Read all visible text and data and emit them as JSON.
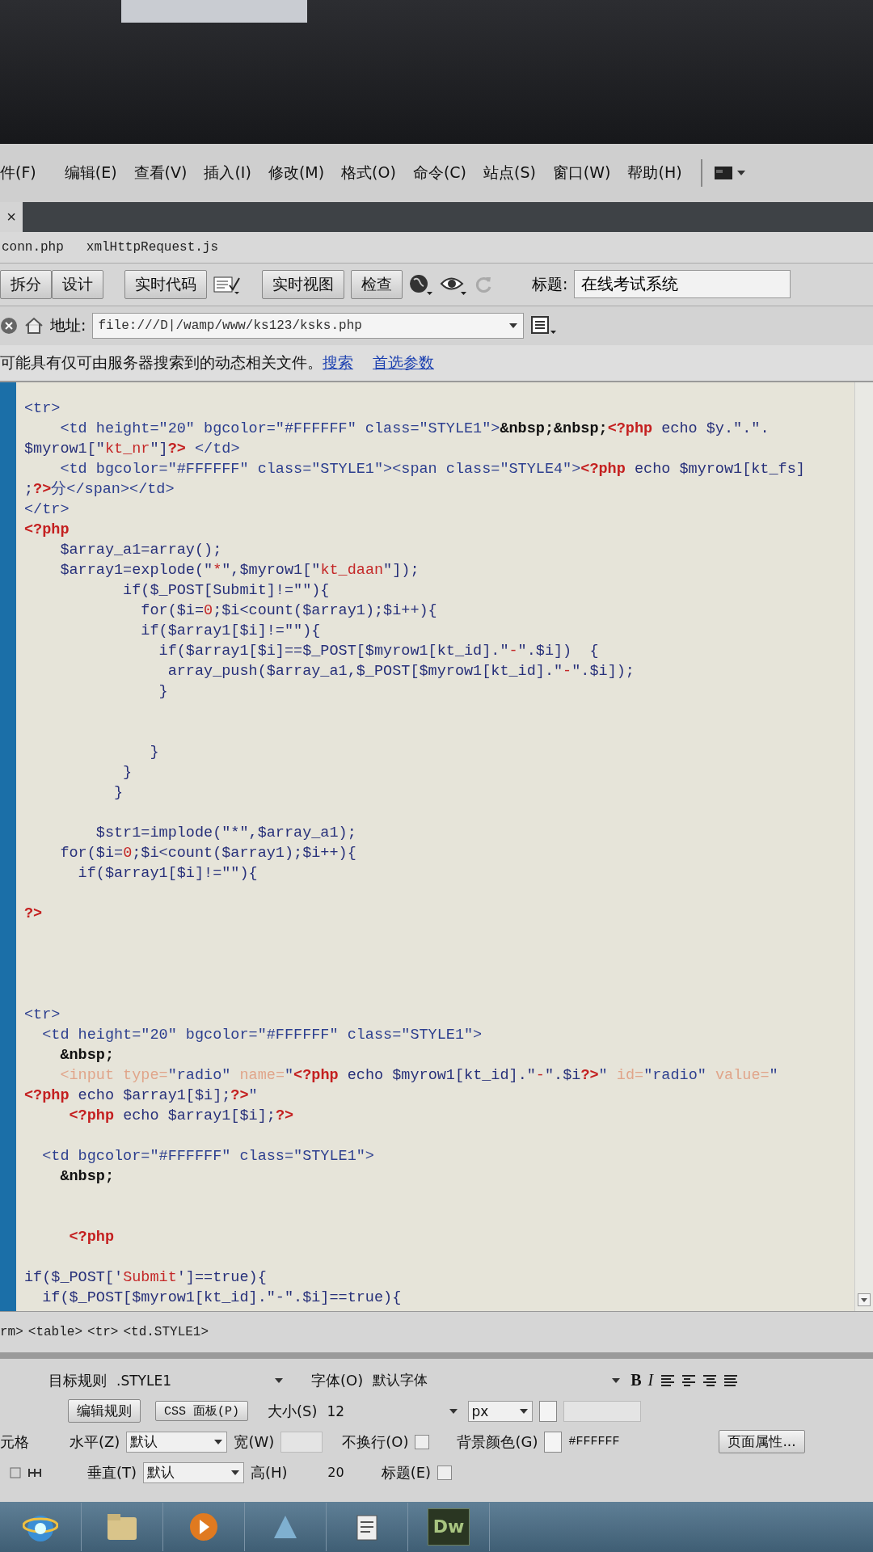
{
  "menu": [
    "件(F)",
    "编辑(E)",
    "查看(V)",
    "插入(I)",
    "修改(M)",
    "格式(O)",
    "命令(C)",
    "站点(S)",
    "窗口(W)",
    "帮助(H)"
  ],
  "close_tab": "×",
  "document_tabs": [
    "conn.php",
    "xmlHttpRequest.js"
  ],
  "toolbar": {
    "view_buttons": [
      "拆分",
      "设计"
    ],
    "live_code_button": "实时代码",
    "live_view_buttons": [
      "实时视图",
      "检查"
    ],
    "title_label": "标题:",
    "title_value": "在线考试系统"
  },
  "address_bar": {
    "label": "地址:",
    "value": "file:///D|/wamp/www/ks123/ksks.php"
  },
  "info_bar": {
    "message": "可能具有仅可由服务器搜索到的动态相关文件。",
    "links": [
      "搜索",
      "首选参数"
    ]
  },
  "code_lines": [
    {
      "kind": "code",
      "segments": [
        {
          "kind": "tag",
          "text": "<tr>"
        }
      ]
    },
    {
      "kind": "code",
      "segments": [
        {
          "kind": "tag",
          "text": "    <td height=\"20\" bgcolor=\"#FFFFFF\" class=\"STYLE1\">"
        },
        {
          "kind": "entity",
          "text": "&nbsp;&nbsp;"
        },
        {
          "kind": "php",
          "text": "<?php"
        },
        {
          "kind": "plain",
          "text": " echo $y.\".\"."
        }
      ]
    },
    {
      "kind": "code",
      "segments": [
        {
          "kind": "plain",
          "text": "$myrow1[\""
        },
        {
          "kind": "string",
          "text": "kt_nr"
        },
        {
          "kind": "plain",
          "text": "\"]"
        },
        {
          "kind": "php",
          "text": "?>"
        },
        {
          "kind": "tag",
          "text": " </td>"
        }
      ]
    },
    {
      "kind": "code",
      "segments": [
        {
          "kind": "tag",
          "text": "    <td bgcolor=\"#FFFFFF\" class=\"STYLE1\"><span class=\"STYLE4\">"
        },
        {
          "kind": "php",
          "text": "<?php"
        },
        {
          "kind": "plain",
          "text": " echo $myrow1[kt_fs]"
        }
      ]
    },
    {
      "kind": "code",
      "segments": [
        {
          "kind": "plain",
          "text": ";"
        },
        {
          "kind": "php",
          "text": "?>"
        },
        {
          "kind": "tag",
          "text": "分</span></td>"
        }
      ]
    },
    {
      "kind": "code",
      "segments": [
        {
          "kind": "tag",
          "text": "</tr>"
        }
      ]
    },
    {
      "kind": "code",
      "segments": [
        {
          "kind": "php",
          "text": "<?php"
        }
      ]
    },
    {
      "kind": "code",
      "segments": [
        {
          "kind": "plain",
          "text": "    $array_a1=array();"
        }
      ]
    },
    {
      "kind": "code",
      "segments": [
        {
          "kind": "plain",
          "text": "    $array1=explode(\""
        },
        {
          "kind": "string",
          "text": "*"
        },
        {
          "kind": "plain",
          "text": "\",$myrow1[\""
        },
        {
          "kind": "string",
          "text": "kt_daan"
        },
        {
          "kind": "plain",
          "text": "\"]);"
        }
      ]
    },
    {
      "kind": "code",
      "segments": [
        {
          "kind": "plain",
          "text": "           if($_POST[Submit]!=\"\"){"
        }
      ]
    },
    {
      "kind": "code",
      "segments": [
        {
          "kind": "plain",
          "text": "             for($i="
        },
        {
          "kind": "string",
          "text": "0"
        },
        {
          "kind": "plain",
          "text": ";$i<count($array1);$i++){"
        }
      ]
    },
    {
      "kind": "code",
      "segments": [
        {
          "kind": "plain",
          "text": "             if($array1[$i]!=\"\"){"
        }
      ]
    },
    {
      "kind": "code",
      "segments": [
        {
          "kind": "plain",
          "text": "               if($array1[$i]==$_POST[$myrow1[kt_id].\""
        },
        {
          "kind": "string",
          "text": "-"
        },
        {
          "kind": "plain",
          "text": "\".$i])  {"
        }
      ]
    },
    {
      "kind": "code",
      "segments": [
        {
          "kind": "plain",
          "text": "                array_push($array_a1,$_POST[$myrow1[kt_id].\""
        },
        {
          "kind": "string",
          "text": "-"
        },
        {
          "kind": "plain",
          "text": "\".$i]);"
        }
      ]
    },
    {
      "kind": "code",
      "segments": [
        {
          "kind": "plain",
          "text": "               }"
        }
      ]
    },
    {
      "kind": "blank"
    },
    {
      "kind": "blank"
    },
    {
      "kind": "code",
      "segments": [
        {
          "kind": "plain",
          "text": "              }"
        }
      ]
    },
    {
      "kind": "code",
      "segments": [
        {
          "kind": "plain",
          "text": "           }"
        }
      ]
    },
    {
      "kind": "code",
      "segments": [
        {
          "kind": "plain",
          "text": "          }"
        }
      ]
    },
    {
      "kind": "blank"
    },
    {
      "kind": "code",
      "segments": [
        {
          "kind": "plain",
          "text": "        $str1=implode(\"*\",$array_a1);"
        }
      ]
    },
    {
      "kind": "code",
      "segments": [
        {
          "kind": "plain",
          "text": "    for($i="
        },
        {
          "kind": "string",
          "text": "0"
        },
        {
          "kind": "plain",
          "text": ";$i<count($array1);$i++){"
        }
      ]
    },
    {
      "kind": "code",
      "segments": [
        {
          "kind": "plain",
          "text": "      if($array1[$i]!=\"\"){"
        }
      ]
    },
    {
      "kind": "blank"
    },
    {
      "kind": "code",
      "segments": [
        {
          "kind": "php",
          "text": "?>"
        }
      ]
    },
    {
      "kind": "blank"
    },
    {
      "kind": "blank"
    },
    {
      "kind": "blank"
    },
    {
      "kind": "blank"
    },
    {
      "kind": "code",
      "segments": [
        {
          "kind": "tag",
          "text": "<tr>"
        }
      ]
    },
    {
      "kind": "code",
      "segments": [
        {
          "kind": "tag",
          "text": "  <td height=\"20\" bgcolor=\"#FFFFFF\" class=\"STYLE1\">"
        }
      ]
    },
    {
      "kind": "code",
      "segments": [
        {
          "kind": "entity",
          "text": "    &nbsp;"
        }
      ]
    },
    {
      "kind": "code",
      "segments": [
        {
          "kind": "faded",
          "text": "    <input type="
        },
        {
          "kind": "tag",
          "text": "\"radio\" "
        },
        {
          "kind": "faded",
          "text": "name="
        },
        {
          "kind": "tag",
          "text": "\""
        },
        {
          "kind": "php",
          "text": "<?php"
        },
        {
          "kind": "plain",
          "text": " echo $myrow1[kt_id].\""
        },
        {
          "kind": "string",
          "text": "-"
        },
        {
          "kind": "plain",
          "text": "\".$i"
        },
        {
          "kind": "php",
          "text": "?>"
        },
        {
          "kind": "tag",
          "text": "\" "
        },
        {
          "kind": "faded",
          "text": "id="
        },
        {
          "kind": "tag",
          "text": "\"radio\" "
        },
        {
          "kind": "faded",
          "text": "value="
        },
        {
          "kind": "tag",
          "text": "\""
        }
      ]
    },
    {
      "kind": "code",
      "segments": [
        {
          "kind": "php",
          "text": "<?php"
        },
        {
          "kind": "plain",
          "text": " echo $array1[$i];"
        },
        {
          "kind": "php",
          "text": "?>"
        },
        {
          "kind": "tag",
          "text": "\""
        }
      ]
    },
    {
      "kind": "code",
      "segments": [
        {
          "kind": "php",
          "text": "     <?php"
        },
        {
          "kind": "plain",
          "text": " echo $array1[$i];"
        },
        {
          "kind": "php",
          "text": "?>"
        }
      ]
    },
    {
      "kind": "blank"
    },
    {
      "kind": "code",
      "segments": [
        {
          "kind": "tag",
          "text": "  <td bgcolor=\"#FFFFFF\" class=\"STYLE1\">"
        }
      ]
    },
    {
      "kind": "code",
      "segments": [
        {
          "kind": "entity",
          "text": "    &nbsp;"
        }
      ]
    },
    {
      "kind": "blank"
    },
    {
      "kind": "blank"
    },
    {
      "kind": "code",
      "segments": [
        {
          "kind": "php",
          "text": "     <?php"
        }
      ]
    },
    {
      "kind": "blank"
    },
    {
      "kind": "code",
      "segments": [
        {
          "kind": "plain",
          "text": "if($_POST['"
        },
        {
          "kind": "string",
          "text": "Submit"
        },
        {
          "kind": "plain",
          "text": "']==true){"
        }
      ]
    },
    {
      "kind": "code",
      "segments": [
        {
          "kind": "plain",
          "text": "  if($_POST[$myrow1[kt_id].\"-\".$i]==true){"
        }
      ]
    }
  ],
  "tag_selector": [
    "rm>",
    "<table>",
    "<tr>",
    "<td.STYLE1>"
  ],
  "properties": {
    "target_rule_label": "目标规则",
    "target_rule_value": ".STYLE1",
    "font_label": "字体(O)",
    "font_value": "默认字体",
    "style_buttons": [
      "B",
      "I"
    ],
    "edit_rule_button": "编辑规则",
    "css_panel_button": "CSS 面板(P)",
    "size_label": "大小(S)",
    "size_value": "12",
    "unit_value": "px",
    "cell_label": "元格",
    "horizontal_label": "水平(Z)",
    "horizontal_value": "默认",
    "width_label": "宽(W)",
    "nowrap_label": "不换行(O)",
    "nowrap_checked": false,
    "bgcolor_label": "背景颜色(G)",
    "bgcolor_value": "#FFFFFF",
    "page_properties_button": "页面属性...",
    "vertical_label": "垂直(T)",
    "vertical_value": "默认",
    "height_label": "高(H)",
    "height_value": "20",
    "header_label": "标题(E)",
    "header_checked": false
  },
  "taskbar": {
    "dw_label": "Dw"
  }
}
